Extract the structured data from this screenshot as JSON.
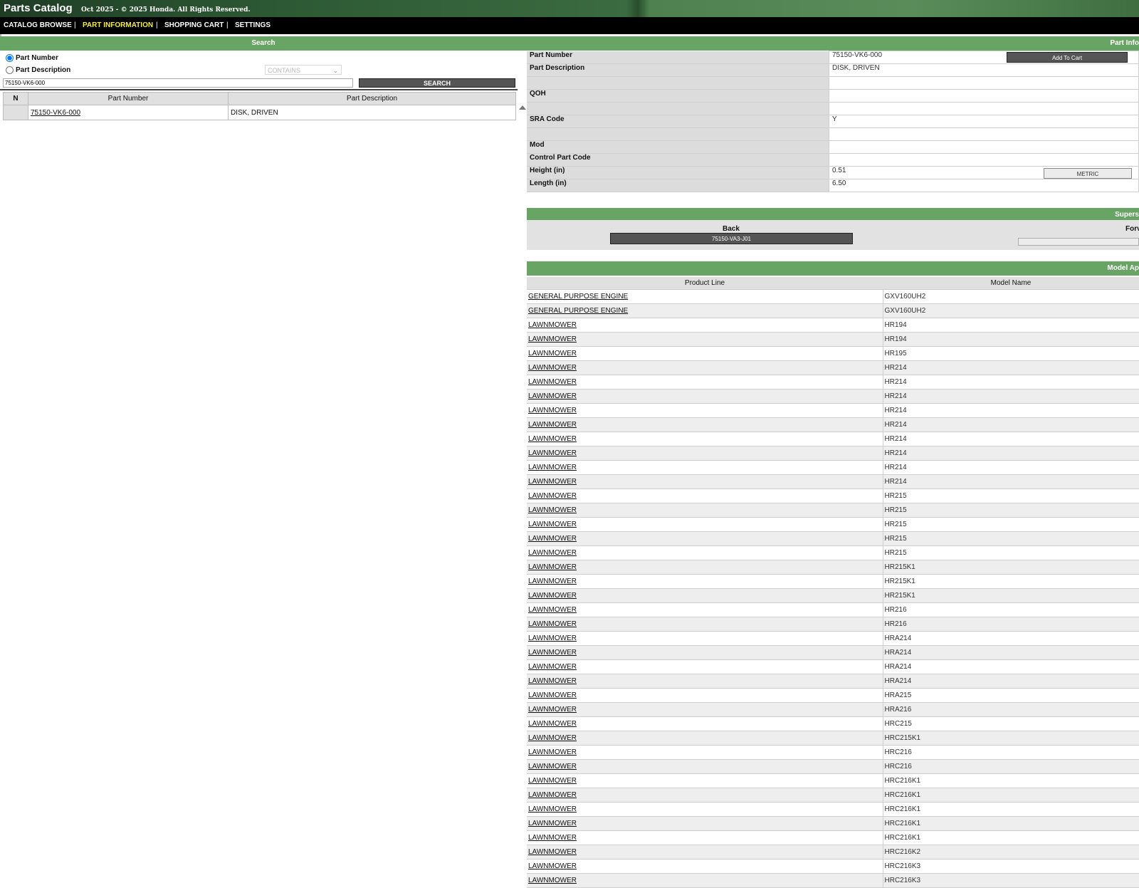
{
  "header": {
    "title": "Parts Catalog",
    "copyright": "Oct 2025 - © 2025 Honda. All Rights Reserved."
  },
  "nav": {
    "items": [
      {
        "label": "CATALOG BROWSE",
        "active": false
      },
      {
        "label": "PART INFORMATION",
        "active": true
      },
      {
        "label": "SHOPPING CART",
        "active": false
      },
      {
        "label": "SETTINGS",
        "active": false
      }
    ],
    "separator": "|"
  },
  "colors": {
    "band": "#68a463",
    "nav_active": "#f7ee34",
    "button": "#555555"
  },
  "search": {
    "title": "Search",
    "radio_part_number": "Part Number",
    "radio_part_description": "Part Description",
    "selected": "Part Number",
    "match_mode": "CONTAINS",
    "input_value": "75150-VK6-000",
    "button_label": "SEARCH"
  },
  "results": {
    "headers": [
      "N",
      "Part Number",
      "Part Description"
    ],
    "rows": [
      {
        "n": "",
        "part_number": "75150-VK6-000",
        "description": "DISK, DRIVEN"
      }
    ]
  },
  "part_info": {
    "title": "Part Info",
    "add_to_cart": "Add To Cart",
    "metric_button": "METRIC",
    "rows": [
      {
        "label": "Part Number",
        "value": "75150-VK6-000"
      },
      {
        "label": "Part Description",
        "value": "DISK, DRIVEN"
      },
      {
        "label": "",
        "value": ""
      },
      {
        "label": "QOH",
        "value": ""
      },
      {
        "label": "",
        "value": ""
      },
      {
        "label": "SRA Code",
        "value": "Y"
      },
      {
        "label": "",
        "value": ""
      },
      {
        "label": "Mod",
        "value": ""
      },
      {
        "label": "Control Part Code",
        "value": ""
      },
      {
        "label": "Height (in)",
        "value": "0.51"
      },
      {
        "label": "Length (in)",
        "value": "6.50"
      }
    ]
  },
  "supersession": {
    "title": "Supers",
    "back_label": "Back",
    "forward_label": "Forv",
    "back_part": "75150-VA3-J01"
  },
  "models": {
    "title": "Model Ap",
    "headers": [
      "Product Line",
      "Model Name"
    ],
    "rows": [
      {
        "product_line": "GENERAL PURPOSE ENGINE",
        "model": "GXV160UH2"
      },
      {
        "product_line": "GENERAL PURPOSE ENGINE",
        "model": "GXV160UH2"
      },
      {
        "product_line": "LAWNMOWER",
        "model": "HR194"
      },
      {
        "product_line": "LAWNMOWER",
        "model": "HR194"
      },
      {
        "product_line": "LAWNMOWER",
        "model": "HR195"
      },
      {
        "product_line": "LAWNMOWER",
        "model": "HR214"
      },
      {
        "product_line": "LAWNMOWER",
        "model": "HR214"
      },
      {
        "product_line": "LAWNMOWER",
        "model": "HR214"
      },
      {
        "product_line": "LAWNMOWER",
        "model": "HR214"
      },
      {
        "product_line": "LAWNMOWER",
        "model": "HR214"
      },
      {
        "product_line": "LAWNMOWER",
        "model": "HR214"
      },
      {
        "product_line": "LAWNMOWER",
        "model": "HR214"
      },
      {
        "product_line": "LAWNMOWER",
        "model": "HR214"
      },
      {
        "product_line": "LAWNMOWER",
        "model": "HR214"
      },
      {
        "product_line": "LAWNMOWER",
        "model": "HR215"
      },
      {
        "product_line": "LAWNMOWER",
        "model": "HR215"
      },
      {
        "product_line": "LAWNMOWER",
        "model": "HR215"
      },
      {
        "product_line": "LAWNMOWER",
        "model": "HR215"
      },
      {
        "product_line": "LAWNMOWER",
        "model": "HR215"
      },
      {
        "product_line": "LAWNMOWER",
        "model": "HR215K1"
      },
      {
        "product_line": "LAWNMOWER",
        "model": "HR215K1"
      },
      {
        "product_line": "LAWNMOWER",
        "model": "HR215K1"
      },
      {
        "product_line": "LAWNMOWER",
        "model": "HR216"
      },
      {
        "product_line": "LAWNMOWER",
        "model": "HR216"
      },
      {
        "product_line": "LAWNMOWER",
        "model": "HRA214"
      },
      {
        "product_line": "LAWNMOWER",
        "model": "HRA214"
      },
      {
        "product_line": "LAWNMOWER",
        "model": "HRA214"
      },
      {
        "product_line": "LAWNMOWER",
        "model": "HRA214"
      },
      {
        "product_line": "LAWNMOWER",
        "model": "HRA215"
      },
      {
        "product_line": "LAWNMOWER",
        "model": "HRA216"
      },
      {
        "product_line": "LAWNMOWER",
        "model": "HRC215"
      },
      {
        "product_line": "LAWNMOWER",
        "model": "HRC215K1"
      },
      {
        "product_line": "LAWNMOWER",
        "model": "HRC216"
      },
      {
        "product_line": "LAWNMOWER",
        "model": "HRC216"
      },
      {
        "product_line": "LAWNMOWER",
        "model": "HRC216K1"
      },
      {
        "product_line": "LAWNMOWER",
        "model": "HRC216K1"
      },
      {
        "product_line": "LAWNMOWER",
        "model": "HRC216K1"
      },
      {
        "product_line": "LAWNMOWER",
        "model": "HRC216K1"
      },
      {
        "product_line": "LAWNMOWER",
        "model": "HRC216K1"
      },
      {
        "product_line": "LAWNMOWER",
        "model": "HRC216K2"
      },
      {
        "product_line": "LAWNMOWER",
        "model": "HRC216K3"
      },
      {
        "product_line": "LAWNMOWER",
        "model": "HRC216K3"
      }
    ]
  }
}
